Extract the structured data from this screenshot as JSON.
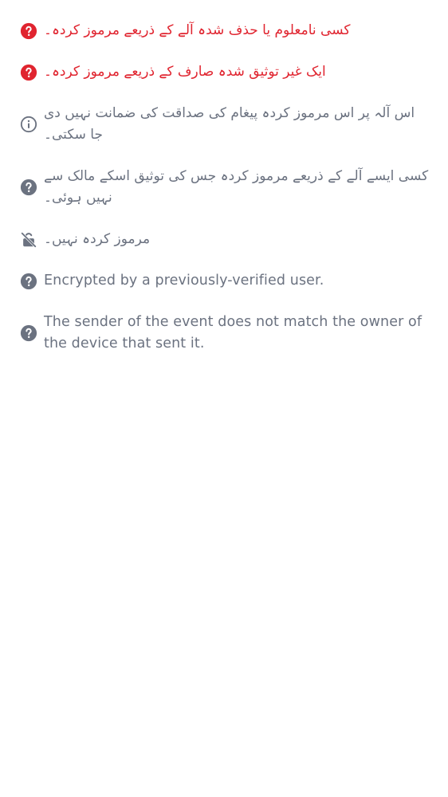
{
  "colors": {
    "critical": "#e0242f",
    "muted": "#6b7280"
  },
  "items": [
    {
      "icon": "question-circle-icon",
      "tone": "critical",
      "text": "کسی نامعلوم یا حذف شدہ آلے کے ذریعے مرموز کردہ۔"
    },
    {
      "icon": "question-circle-icon",
      "tone": "critical",
      "text": "ایک غیر توثیق شدہ صارف کے ذریعے مرموز کردہ۔"
    },
    {
      "icon": "info-circle-icon",
      "tone": "muted",
      "text": "اس آلہ پر اس مرموز کردہ پیغام کی صداقت کی ضمانت نہیں دی جا سکتی۔"
    },
    {
      "icon": "question-circle-icon",
      "tone": "muted",
      "text": "کسی ایسے آلے کے ذریعے مرموز کردہ جس کی توثیق اسکے مالک سے نہیں ہوئی۔"
    },
    {
      "icon": "unlocked-off-icon",
      "tone": "muted",
      "text": "مرموز کردہ نہیں۔"
    },
    {
      "icon": "question-circle-icon",
      "tone": "muted",
      "text": "Encrypted by a previously-verified user."
    },
    {
      "icon": "question-circle-icon",
      "tone": "muted",
      "text": "The sender of the event does not match the owner of the device that sent it."
    }
  ]
}
